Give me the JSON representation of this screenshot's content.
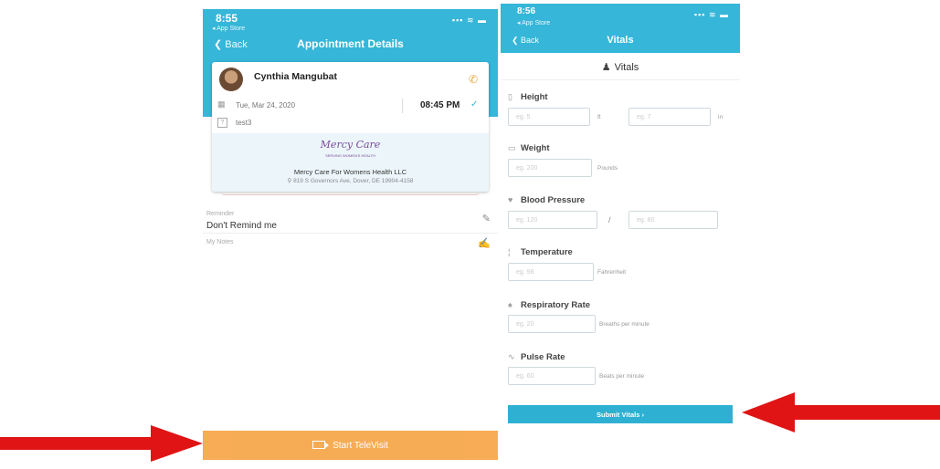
{
  "left_screen": {
    "status": {
      "time": "8:55",
      "subtitle": "◂ App Store",
      "icons": "▪▪▪ ≋ ▬"
    },
    "nav": {
      "back": "❮ Back",
      "title": "Appointment Details"
    },
    "patient": {
      "name": "Cynthia Mangubat"
    },
    "appointment": {
      "date": "Tue, Mar 24, 2020",
      "time": "08:45 PM",
      "reason": "test3"
    },
    "clinic": {
      "logo_text": "Mercy Care",
      "logo_tagline": "SERVING WOMEN'S HEALTH",
      "name": "Mercy Care For Womens Health LLC",
      "address": "819 S Governors Ave, Dover, DE 19904-4158"
    },
    "reminder": {
      "label": "Reminder",
      "value": "Don't Remind me"
    },
    "notes": {
      "label": "My Notes"
    },
    "start_televisit_label": "Start TeleVisit"
  },
  "right_screen": {
    "status": {
      "time": "8:56",
      "subtitle": "◂ App Store",
      "icons": "▪▪▪ ≋ ▬"
    },
    "nav": {
      "back": "❮ Back",
      "title": "Vitals"
    },
    "header": "Vitals",
    "height": {
      "label": "Height",
      "ft_placeholder": "eg. 5",
      "ft_unit": "ft",
      "in_placeholder": "eg. 7",
      "in_unit": "in"
    },
    "weight": {
      "label": "Weight",
      "placeholder": "eg. 200",
      "unit": "Pounds"
    },
    "blood_pressure": {
      "label": "Blood Pressure",
      "sys_placeholder": "eg. 120",
      "separator": "/",
      "dia_placeholder": "eg. 80"
    },
    "temperature": {
      "label": "Temperature",
      "placeholder": "eg. 98",
      "unit": "Fahrenheit"
    },
    "respiratory_rate": {
      "label": "Respiratory Rate",
      "placeholder": "eg. 20",
      "unit": "Breaths per minute"
    },
    "pulse_rate": {
      "label": "Pulse Rate",
      "placeholder": "eg. 60",
      "unit": "Beats per minute"
    },
    "submit_label": "Submit Vitals ›"
  },
  "colors": {
    "header": "#36b6d8",
    "televisit_button": "#f6a546",
    "submit_button": "#2eb0d2",
    "arrow": "#e01414"
  }
}
